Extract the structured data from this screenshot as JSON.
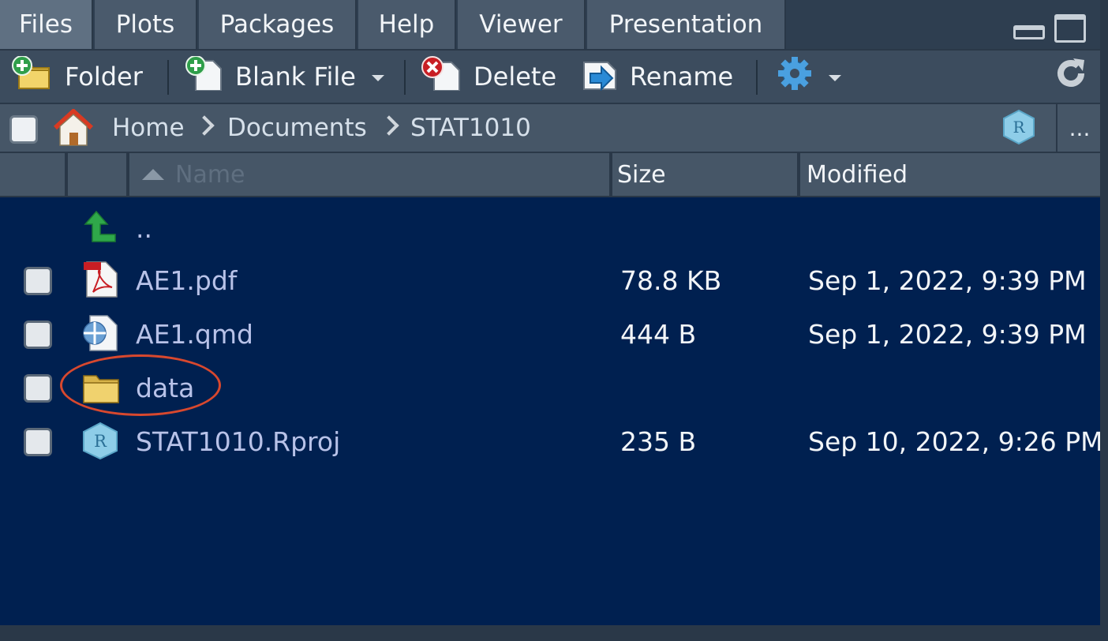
{
  "tabs": [
    {
      "label": "Files",
      "active": true
    },
    {
      "label": "Plots"
    },
    {
      "label": "Packages"
    },
    {
      "label": "Help"
    },
    {
      "label": "Viewer"
    },
    {
      "label": "Presentation"
    }
  ],
  "toolbar": {
    "new_folder_label": "Folder",
    "new_blank_file_label": "Blank File",
    "delete_label": "Delete",
    "rename_label": "Rename",
    "more_icon": "gear-icon",
    "refresh_icon": "refresh-icon"
  },
  "breadcrumb": {
    "items": [
      "Home",
      "Documents",
      "STAT1010"
    ],
    "more_label": "..."
  },
  "columns": {
    "name": "Name",
    "size": "Size",
    "modified": "Modified"
  },
  "files": [
    {
      "name": "..",
      "icon": "up-arrow-icon",
      "size": "",
      "modified": ""
    },
    {
      "name": "AE1.pdf",
      "icon": "pdf-icon",
      "size": "78.8 KB",
      "modified": "Sep 1, 2022, 9:39 PM"
    },
    {
      "name": "AE1.qmd",
      "icon": "quarto-icon",
      "size": "444 B",
      "modified": "Sep 1, 2022, 9:39 PM"
    },
    {
      "name": "data",
      "icon": "folder-icon",
      "size": "",
      "modified": ""
    },
    {
      "name": "STAT1010.Rproj",
      "icon": "rproj-icon",
      "size": "235 B",
      "modified": "Sep 10, 2022, 9:26 PM"
    }
  ],
  "colors": {
    "list_background": "#002050",
    "annotation": "#d8482e",
    "filename": "#b8c2e8"
  }
}
